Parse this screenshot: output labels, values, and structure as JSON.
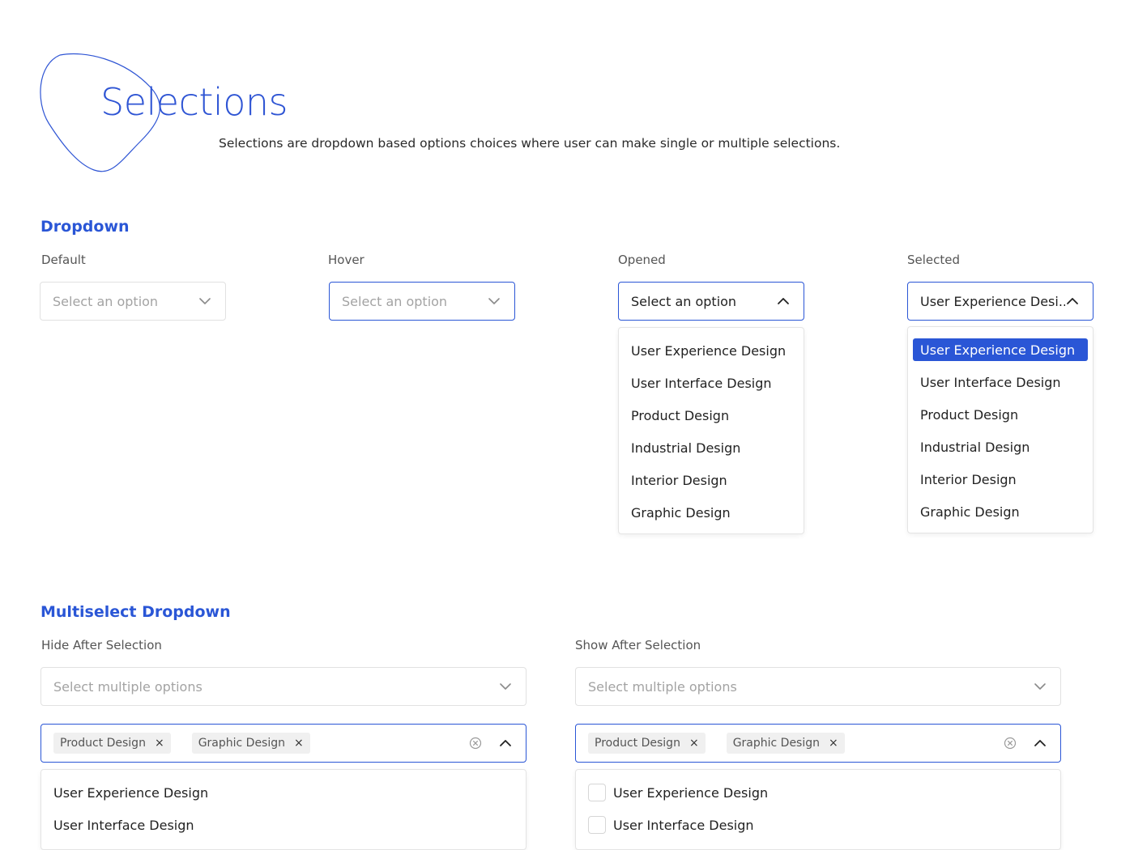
{
  "hero": {
    "title": "Selections",
    "subtitle": "Selections are dropdown based options choices where user can make single or multiple selections."
  },
  "dropdown": {
    "section_title": "Dropdown",
    "default": {
      "label": "Default",
      "placeholder": "Select an option"
    },
    "hover": {
      "label": "Hover",
      "placeholder": "Select an option"
    },
    "opened": {
      "label": "Opened",
      "placeholder": "Select an option"
    },
    "selected": {
      "label": "Selected",
      "value": "User Experience Desi.."
    },
    "options": [
      "User Experience Design",
      "User Interface Design",
      "Product Design",
      "Industrial Design",
      "Interior Design",
      "Graphic Design"
    ]
  },
  "multiselect": {
    "section_title": "Multiselect Dropdown",
    "hide": {
      "label": "Hide After Selection",
      "placeholder": "Select multiple options",
      "chips": [
        "Product Design",
        "Graphic Design"
      ],
      "options": [
        "User Experience Design",
        "User Interface Design"
      ]
    },
    "show": {
      "label": "Show After Selection",
      "placeholder": "Select multiple options",
      "chips": [
        "Product Design",
        "Graphic Design"
      ],
      "options": [
        "User Experience Design",
        "User Interface Design"
      ]
    },
    "chip_remove_glyph": "×"
  },
  "colors": {
    "accent": "#2a56d6",
    "border": "#e1e1e1",
    "chip_bg": "#f0f0f0"
  },
  "icons": {
    "chevron_down": "chevron-down-icon",
    "chevron_up": "chevron-up-icon",
    "clear": "clear-circle-icon",
    "remove": "close-icon"
  }
}
